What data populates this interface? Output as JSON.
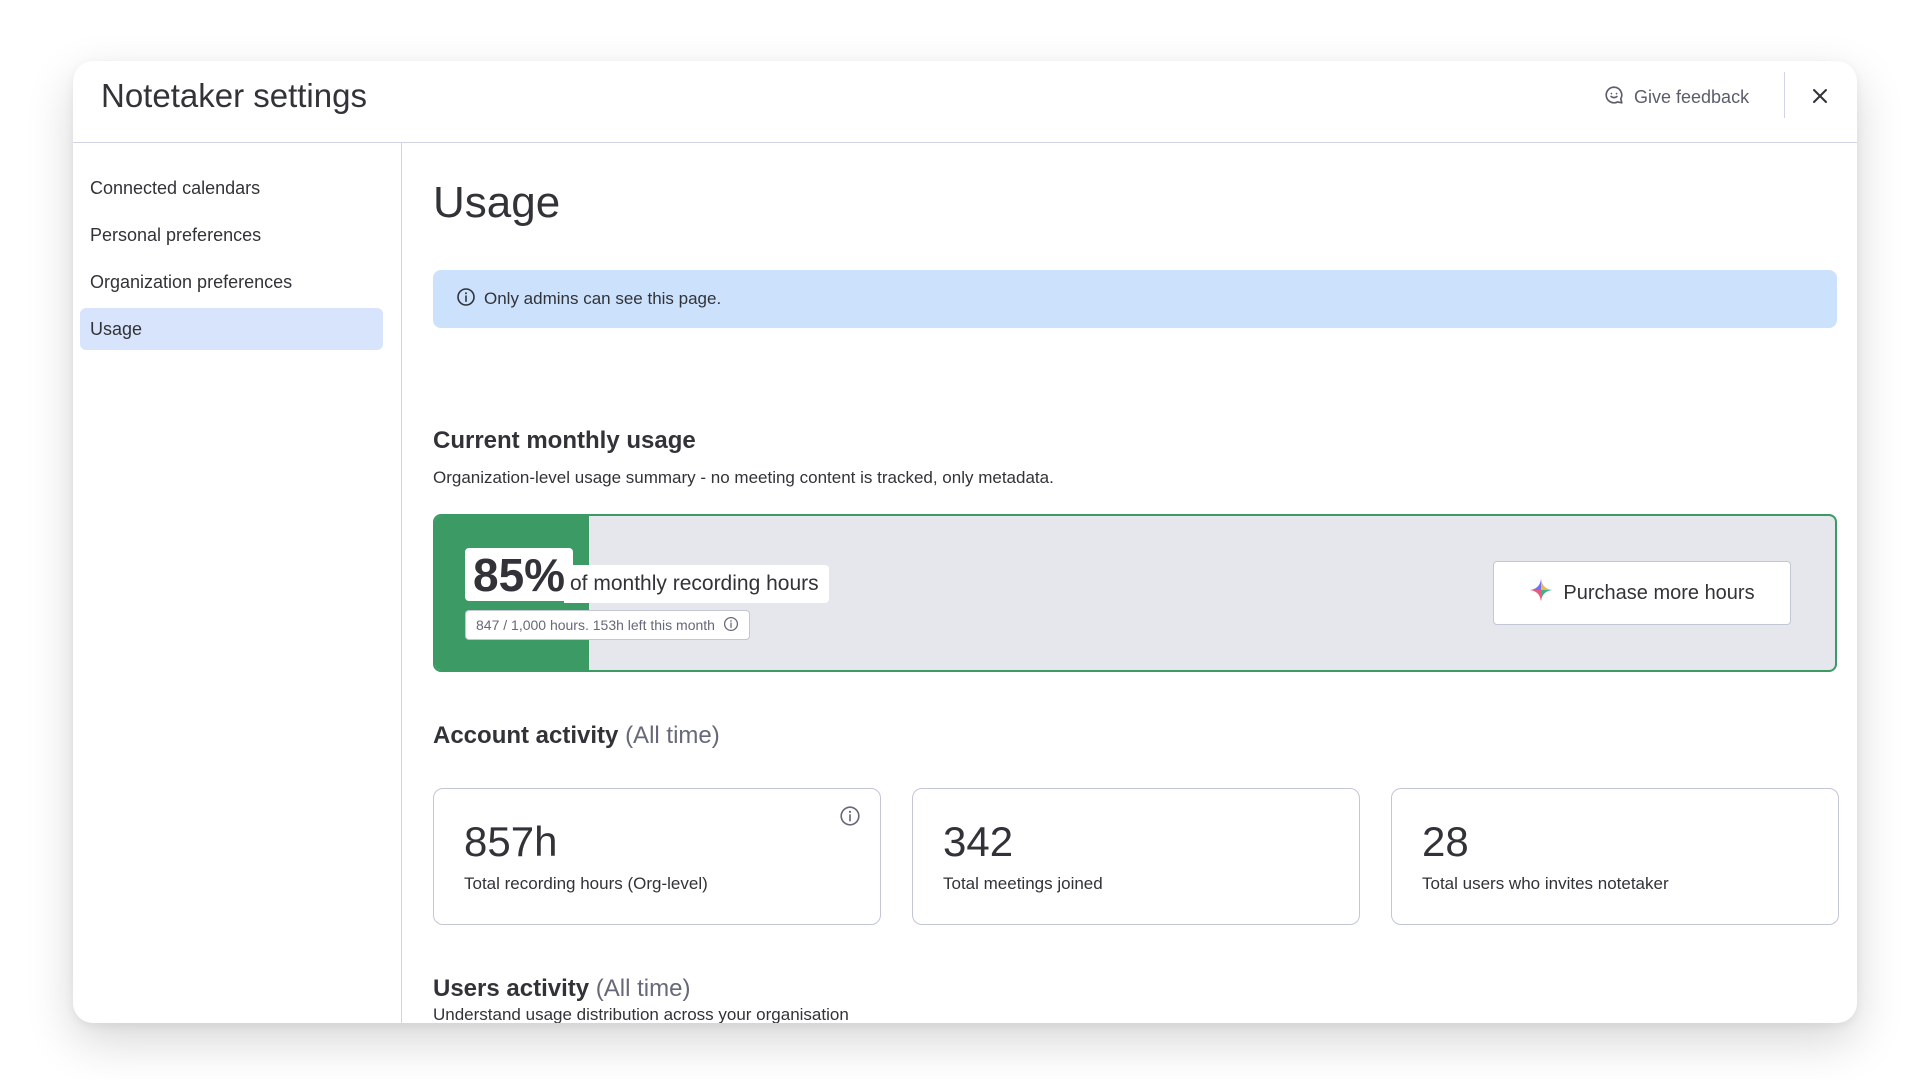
{
  "modal": {
    "title": "Notetaker settings",
    "feedback_label": "Give feedback"
  },
  "sidebar": {
    "items": [
      {
        "label": "Connected calendars"
      },
      {
        "label": "Personal preferences"
      },
      {
        "label": "Organization preferences"
      },
      {
        "label": "Usage",
        "active": true
      }
    ]
  },
  "main": {
    "title": "Usage",
    "banner_text": "Only admins can see this page.",
    "monthly": {
      "title": "Current monthly usage",
      "subtitle": "Organization-level usage summary - no meeting content is tracked, only metadata.",
      "percent_label": "85%",
      "percent_fill": 0.11,
      "caption": "of monthly recording hours",
      "detail": "847 / 1,000 hours. 153h left this month",
      "purchase_label": "Purchase more hours"
    },
    "account_activity": {
      "title": "Account activity",
      "qualifier": "(All time)",
      "stats": [
        {
          "value": "857h",
          "label": "Total recording hours (Org-level)"
        },
        {
          "value": "342",
          "label": "Total meetings joined"
        },
        {
          "value": "28",
          "label": "Total users who invites notetaker"
        }
      ]
    },
    "users_activity": {
      "title": "Users activity",
      "qualifier": "(All time)",
      "subtitle": "Understand usage distribution across your organisation"
    }
  },
  "colors": {
    "accent_green": "#3c9a64",
    "banner_blue": "#cce1fc",
    "active_item": "#d7e4fb",
    "card_gray": "#e6e7ec"
  },
  "icons": {
    "feedback": "chat-bubble-smile-icon",
    "close": "close-icon",
    "info": "info-icon",
    "sparkle": "sparkle-icon"
  }
}
